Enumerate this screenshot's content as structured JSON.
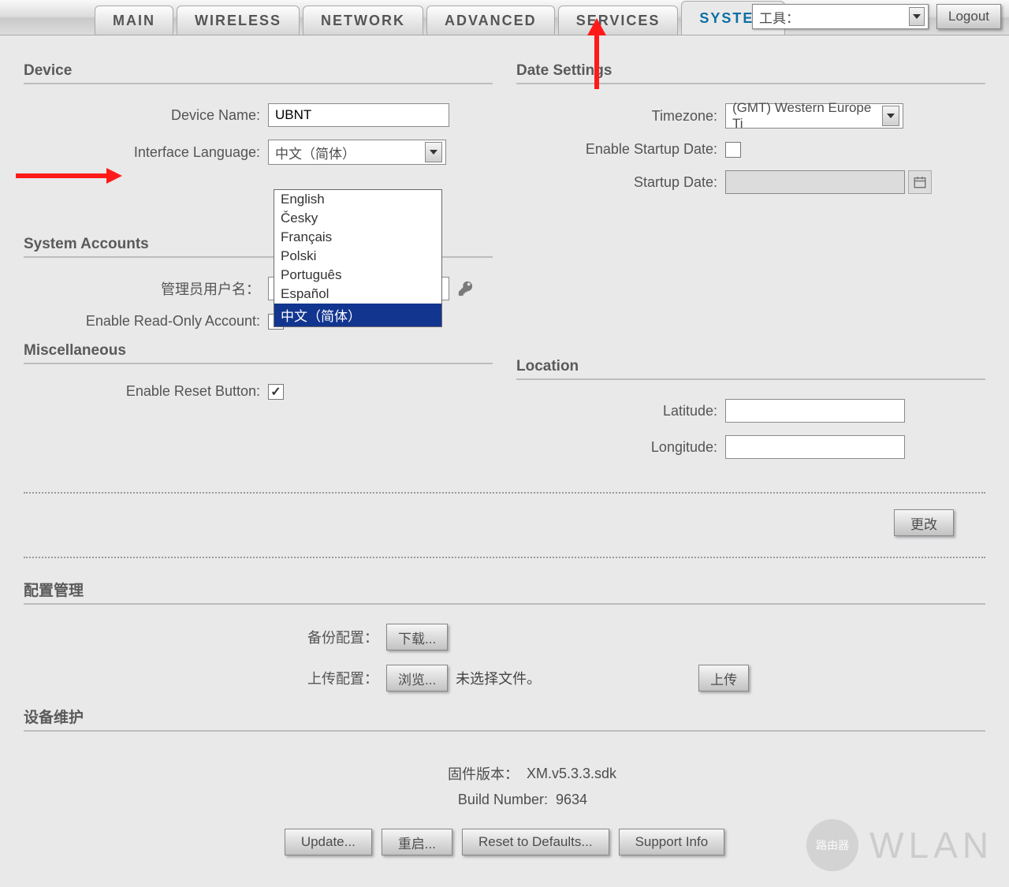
{
  "tabs": {
    "main": "MAIN",
    "wireless": "WIRELESS",
    "network": "NETWORK",
    "advanced": "ADVANCED",
    "services": "SERVICES",
    "system": "SYSTEM"
  },
  "top": {
    "tools_label": "工具：",
    "logout": "Logout"
  },
  "sections": {
    "device": "Device",
    "date": "Date Settings",
    "accounts": "System Accounts",
    "misc": "Miscellaneous",
    "location": "Location",
    "config": "配置管理",
    "maint": "设备维护"
  },
  "device": {
    "name_label": "Device Name:",
    "name_value": "UBNT",
    "lang_label": "Interface Language:",
    "lang_value": "中文（简体）",
    "lang_options": {
      "en": "English",
      "cs": "Česky",
      "fr": "Français",
      "pl": "Polski",
      "pt": "Português",
      "es": "Español",
      "zh": "中文（简体）"
    }
  },
  "date": {
    "tz_label": "Timezone:",
    "tz_value": "(GMT) Western Europe Ti",
    "enable_startup_label": "Enable Startup Date:",
    "startup_label": "Startup Date:",
    "startup_value": ""
  },
  "accounts": {
    "admin_user_label": "管理员用户名：",
    "admin_user_value": "",
    "readonly_label": "Enable Read-Only Account:"
  },
  "misc": {
    "reset_label": "Enable Reset Button:"
  },
  "location": {
    "lat_label": "Latitude:",
    "lat_value": "",
    "lon_label": "Longitude:",
    "lon_value": ""
  },
  "buttons": {
    "change": "更改",
    "download": "下载...",
    "browse": "浏览...",
    "upload": "上传",
    "update": "Update...",
    "reboot": "重启...",
    "reset": "Reset to Defaults...",
    "support": "Support Info"
  },
  "config": {
    "backup_label": "备份配置：",
    "upload_label": "上传配置：",
    "no_file": "未选择文件。"
  },
  "maint": {
    "fw_label": "固件版本：",
    "fw_value": "XM.v5.3.3.sdk",
    "build_label": "Build Number:",
    "build_value": "9634"
  },
  "watermark": {
    "text": "WLAN",
    "badge": "路由器"
  }
}
